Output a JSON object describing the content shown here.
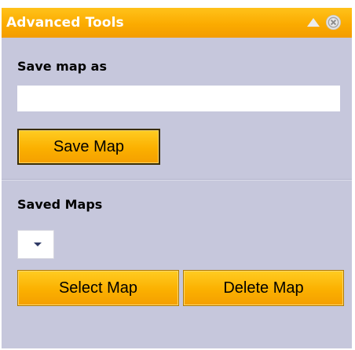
{
  "panel": {
    "title": "Advanced Tools",
    "collapse_icon": "triangle-up-icon",
    "close_icon": "close-circle-icon"
  },
  "save_section": {
    "label": "Save map as",
    "input_value": "",
    "input_placeholder": "",
    "button_label": "Save Map"
  },
  "saved_section": {
    "label": "Saved Maps",
    "selected_value": "",
    "dropdown_icon": "chevron-down-icon",
    "select_button_label": "Select Map",
    "delete_button_label": "Delete Map"
  },
  "colors": {
    "title_bar": "#fbab00",
    "panel_background": "#c6c7dc",
    "button_fill": "#fbb000",
    "title_text": "#ffffff"
  }
}
